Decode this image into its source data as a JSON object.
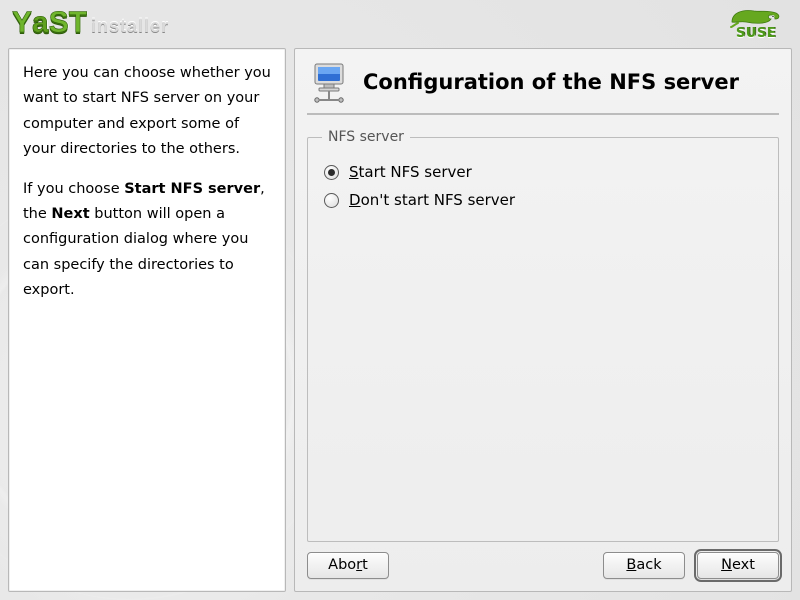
{
  "header": {
    "app_name_main": "YaST",
    "app_name_sub": "installer",
    "suse_label": "SUSE"
  },
  "side": {
    "p1": "Here you can choose whether you want to start NFS server on your computer and export some of your directories to the others.",
    "p2_pre": "If you choose ",
    "p2_b1": "Start NFS server",
    "p2_mid": ", the ",
    "p2_b2": "Next",
    "p2_post": " button will open a configuration dialog where you can specify the directories to export."
  },
  "main": {
    "title": "Configuration of the NFS server",
    "fieldset_legend": "NFS server",
    "options": {
      "start": {
        "accel": "S",
        "rest": "tart NFS server",
        "selected": true
      },
      "dont": {
        "accel": "D",
        "rest": "on't start NFS server",
        "selected": false
      }
    }
  },
  "buttons": {
    "abort": {
      "pre": "Abo",
      "accel": "r",
      "post": "t"
    },
    "back": {
      "pre": "",
      "accel": "B",
      "post": "ack"
    },
    "next": {
      "pre": "",
      "accel": "N",
      "post": "ext",
      "default": true
    }
  }
}
